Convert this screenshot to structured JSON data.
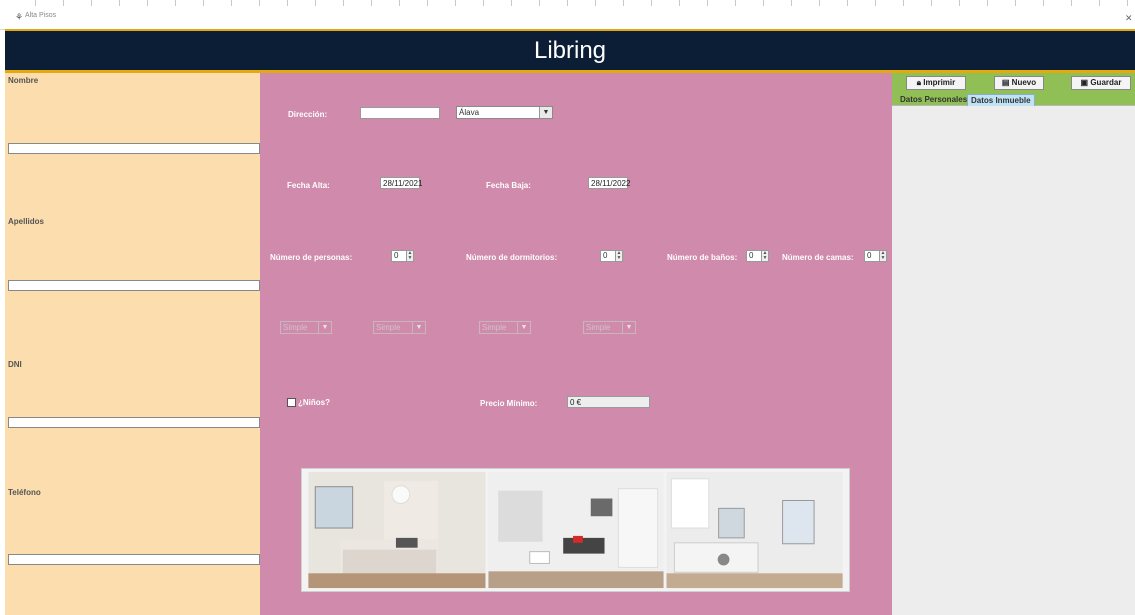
{
  "window": {
    "title": "Alta Pisos",
    "close_glyph": "✕",
    "icon": "app-icon"
  },
  "header": {
    "title": "Libring",
    "colors": {
      "background": "#0c1e36",
      "accent": "#e4a90f"
    }
  },
  "personal": {
    "nombre_label": "Nombre",
    "nombre_value": "",
    "apellidos_label": "Apellidos",
    "apellidos_value": "",
    "dni_label": "DNI",
    "dni_value": "",
    "telefono_label": "Teléfono",
    "telefono_value": ""
  },
  "inmueble": {
    "direccion_label": "Dirección:",
    "direccion_value": "",
    "provincia_value": "Álava",
    "fecha_alta_label": "Fecha Alta:",
    "fecha_alta_value": "28/11/2021",
    "fecha_baja_label": "Fecha Baja:",
    "fecha_baja_value": "28/11/2022",
    "personas_label": "Número de personas:",
    "personas_value": "0",
    "dormitorios_label": "Número de dormitorios:",
    "dormitorios_value": "0",
    "banos_label": "Número de baños:",
    "banos_value": "0",
    "camas_label": "Número de camas:",
    "camas_value": "0",
    "cama_tipos": [
      "Simple",
      "Simple",
      "Simple",
      "Simple"
    ],
    "ninos_label": "¿Niños?",
    "ninos_checked": false,
    "precio_label": "Precio Mínimo:",
    "precio_value": "0 €"
  },
  "toolbar": {
    "imprimir": "Imprimir",
    "nuevo": "Nuevo",
    "guardar": "Guardar"
  },
  "tabs": [
    {
      "label": "Datos Personales",
      "active": false
    },
    {
      "label": "Datos Inmueble",
      "active": true
    }
  ],
  "colors": {
    "left_panel": "#fcddad",
    "center_panel": "#d08aab",
    "toolbar": "#8fbf55"
  }
}
